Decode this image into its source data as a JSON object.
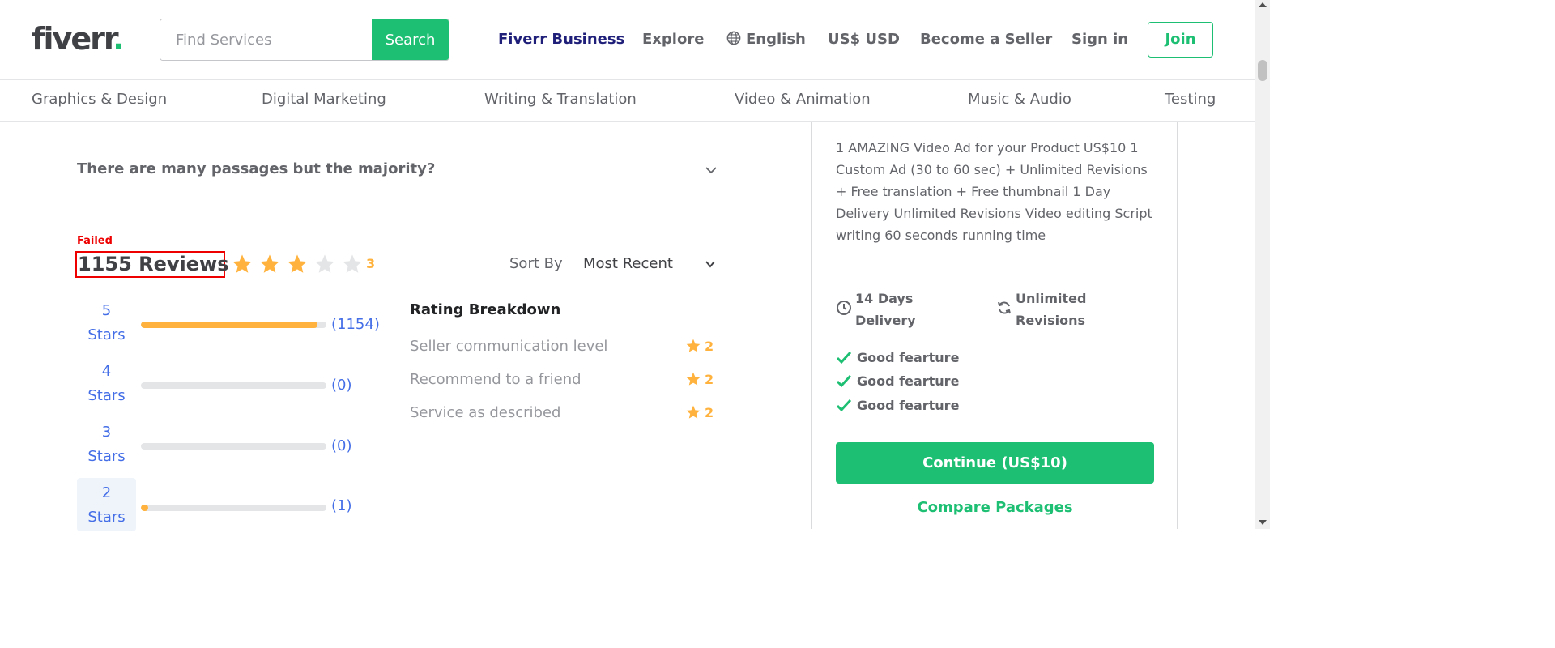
{
  "header": {
    "logo_text": "fiverr",
    "logo_dot": ".",
    "search_placeholder": "Find Services",
    "search_button": "Search",
    "nav": {
      "business": "Fiverr Business",
      "explore": "Explore",
      "language": "English",
      "currency": "US$ USD",
      "become_seller": "Become a Seller",
      "sign_in": "Sign in",
      "join": "Join"
    }
  },
  "categories": [
    "Graphics & Design",
    "Digital Marketing",
    "Writing & Translation",
    "Video & Animation",
    "Music & Audio",
    "Testing"
  ],
  "faq": {
    "question": "There are many passages but the majority?"
  },
  "reviews": {
    "failed_label": "Failed",
    "title": "1155 Reviews",
    "rating": "3",
    "rating_value": 3,
    "max_rating": 5,
    "sort_label": "Sort By",
    "sort_value": "Most Recent",
    "distribution": [
      {
        "label_num": "5",
        "label_word": "Stars",
        "count": "(1154)",
        "fraction": 0.95
      },
      {
        "label_num": "4",
        "label_word": "Stars",
        "count": "(0)",
        "fraction": 0
      },
      {
        "label_num": "3",
        "label_word": "Stars",
        "count": "(0)",
        "fraction": 0
      },
      {
        "label_num": "2",
        "label_word": "Stars",
        "count": "(1)",
        "fraction": 0.04
      }
    ],
    "breakdown_title": "Rating Breakdown",
    "breakdown": [
      {
        "name": "Seller communication level",
        "value": "2"
      },
      {
        "name": "Recommend to a friend",
        "value": "2"
      },
      {
        "name": "Service as described",
        "value": "2"
      }
    ]
  },
  "package": {
    "description": "1 AMAZING Video Ad for your Product US$10 1 Custom Ad (30 to 60 sec) + Unlimited Revisions + Free translation + Free thumbnail 1 Day Delivery Unlimited Revisions Video editing Script writing 60 seconds running time",
    "delivery_line1": "14 Days",
    "delivery_line2": "Delivery",
    "revisions_line1": "Unlimited",
    "revisions_line2": "Revisions",
    "features": [
      "Good fearture",
      "Good fearture",
      "Good fearture"
    ],
    "continue_button": "Continue (US$10)",
    "compare_link": "Compare Packages"
  },
  "colors": {
    "brand_green": "#1dbf73",
    "star_yellow": "#ffb33e",
    "link_blue": "#446ee7",
    "error_red": "#ee0000"
  }
}
